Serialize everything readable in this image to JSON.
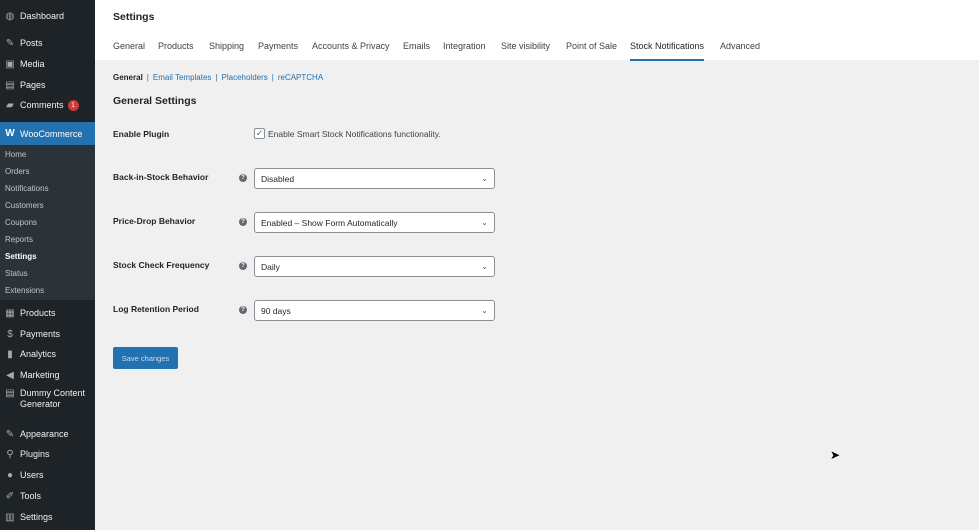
{
  "sidebar": {
    "top": [
      {
        "label": "Dashboard",
        "icon": "dashboard-icon",
        "g": "◍"
      },
      {
        "label": "Posts",
        "icon": "pin-icon",
        "g": "✎"
      },
      {
        "label": "Media",
        "icon": "media-icon",
        "g": "▣"
      },
      {
        "label": "Pages",
        "icon": "pages-icon",
        "g": "▤"
      },
      {
        "label": "Comments",
        "icon": "comment-icon",
        "g": "▰",
        "badge": "1"
      }
    ],
    "woocommerce": "WooCommerce",
    "sub": [
      "Home",
      "Orders",
      "Notifications",
      "Customers",
      "Coupons",
      "Reports",
      "Settings",
      "Status",
      "Extensions"
    ],
    "bottom": [
      {
        "label": "Products",
        "g": "▦"
      },
      {
        "label": "Payments",
        "g": "$"
      },
      {
        "label": "Analytics",
        "g": "▮"
      },
      {
        "label": "Marketing",
        "g": "◀"
      },
      {
        "label": "Dummy Content Generator",
        "g": "▤"
      },
      {
        "label": "Appearance",
        "g": "✎"
      },
      {
        "label": "Plugins",
        "g": "⚲"
      },
      {
        "label": "Users",
        "g": "●"
      },
      {
        "label": "Tools",
        "g": "✐"
      },
      {
        "label": "Settings",
        "g": "▥"
      }
    ]
  },
  "header": {
    "title": "Settings",
    "tabs": [
      "General",
      "Products",
      "Shipping",
      "Payments",
      "Accounts & Privacy",
      "Emails",
      "Integration",
      "Site visibility",
      "Point of Sale",
      "Stock Notifications",
      "Advanced"
    ],
    "active_tab": "Stock Notifications"
  },
  "subnav": [
    "General",
    "Email Templates",
    "Placeholders",
    "reCAPTCHA"
  ],
  "section_title": "General Settings",
  "enable": {
    "label": "Enable Plugin",
    "checkbox": "Enable Smart Stock Notifications functionality.",
    "checked": true
  },
  "fields": [
    {
      "label": "Back-in-Stock Behavior",
      "value": "Disabled"
    },
    {
      "label": "Price-Drop Behavior",
      "value": "Enabled – Show Form Automatically"
    },
    {
      "label": "Stock Check Frequency",
      "value": "Daily"
    },
    {
      "label": "Log Retention Period",
      "value": "90 days"
    }
  ],
  "save": "Save changes"
}
